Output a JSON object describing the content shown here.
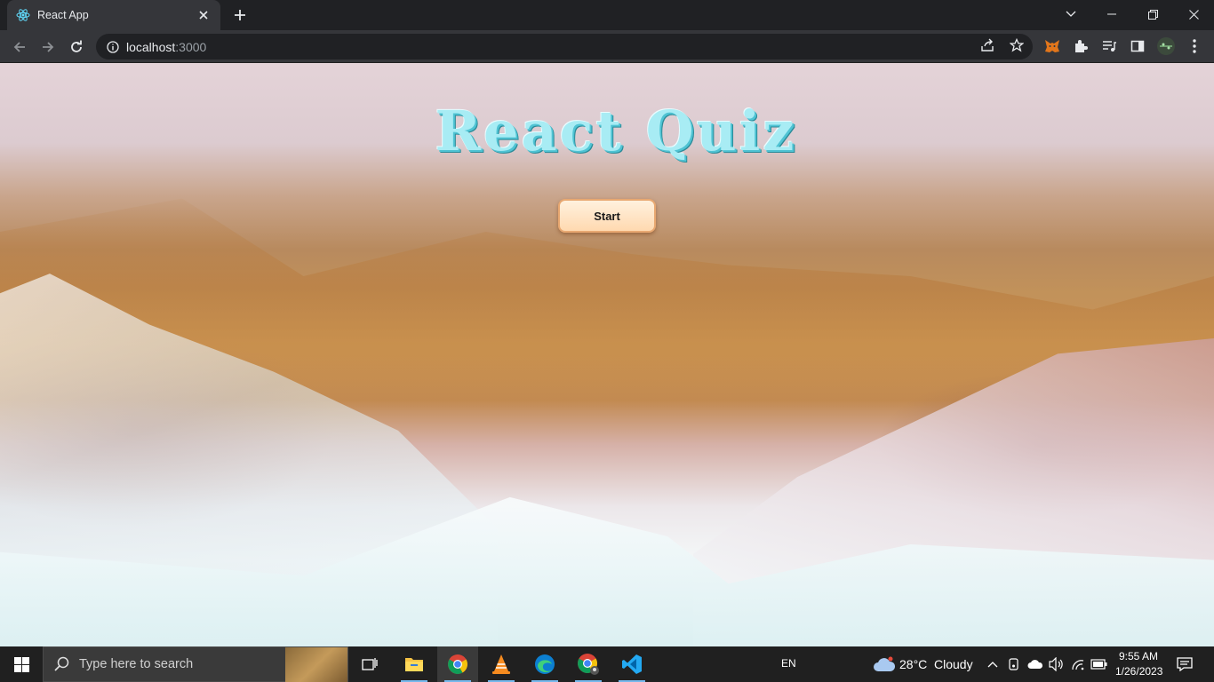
{
  "browser": {
    "tab": {
      "title": "React App"
    },
    "url": {
      "host": "localhost",
      "port": ":3000"
    }
  },
  "app": {
    "title": "React Quiz",
    "start_label": "Start"
  },
  "taskbar": {
    "search_placeholder": "Type here to search",
    "language": "EN",
    "weather": {
      "temp": "28°C",
      "condition": "Cloudy"
    },
    "clock": {
      "time": "9:55 AM",
      "date": "1/26/2023"
    }
  },
  "colors": {
    "title_fill": "#a8ecf4",
    "start_button_bg": "#ffd9b0",
    "chrome_dark": "#202124",
    "chrome_toolbar": "#35363a"
  },
  "icons": [
    "react-favicon-icon",
    "close-icon",
    "plus-icon",
    "chevron-down-icon",
    "minimize-icon",
    "restore-icon",
    "window-close-icon",
    "back-icon",
    "forward-icon",
    "reload-icon",
    "info-icon",
    "share-icon",
    "star-icon",
    "metamask-icon",
    "puzzle-icon",
    "media-icon",
    "sidepanel-icon",
    "profile-icon",
    "menu-icon",
    "windows-icon",
    "search-icon",
    "task-view-icon",
    "file-explorer-icon",
    "chrome-icon",
    "vlc-icon",
    "edge-icon",
    "chrome-profile-icon",
    "vscode-icon",
    "cloud-icon",
    "chevron-up-icon",
    "meet-icon",
    "onedrive-icon",
    "volume-icon",
    "wifi-icon",
    "battery-icon",
    "notification-icon"
  ]
}
